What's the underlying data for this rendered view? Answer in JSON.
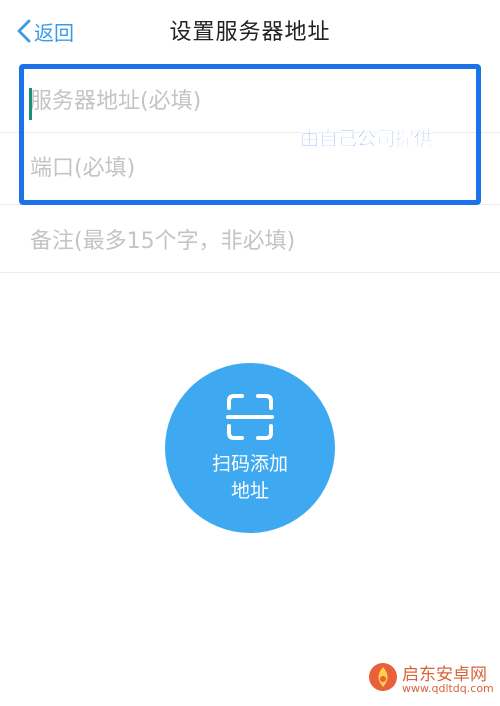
{
  "header": {
    "back_label": "返回",
    "title": "设置服务器地址"
  },
  "form": {
    "server_placeholder": "服务器地址(必填)",
    "port_placeholder": "端口(必填)",
    "remark_placeholder": "备注(最多15个字，非必填)"
  },
  "annotation": {
    "text": "由自己公司提供"
  },
  "scan": {
    "label": "扫码添加\n地址"
  },
  "watermark": {
    "name": "启东安卓网",
    "url": "www.qdltdq.com"
  },
  "colors": {
    "accent": "#3ea8f0",
    "annotation": "#1a73e8",
    "watermark": "#d9633a"
  }
}
